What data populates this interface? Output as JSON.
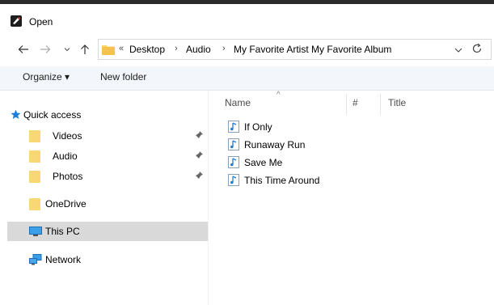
{
  "window": {
    "title": "Open"
  },
  "nav": {
    "back_icon": "back-arrow-icon",
    "forward_icon": "forward-arrow-icon",
    "recent_icon": "chevron-down-icon",
    "up_icon": "up-arrow-icon"
  },
  "address": {
    "overflow": "«",
    "crumbs": [
      "Desktop",
      "Audio",
      "My Favorite Artist My Favorite Album"
    ],
    "separator": "›"
  },
  "toolbar": {
    "organize_label": "Organize ▾",
    "new_folder_label": "New folder"
  },
  "sidebar": {
    "quick_access": "Quick access",
    "items": [
      {
        "label": "Videos",
        "pinned": true
      },
      {
        "label": "Audio",
        "pinned": true
      },
      {
        "label": "Photos",
        "pinned": true
      }
    ],
    "onedrive": "OneDrive",
    "this_pc": "This PC",
    "network": "Network"
  },
  "columns": {
    "name": "Name",
    "number": "#",
    "title": "Title"
  },
  "files": [
    {
      "name": "If Only"
    },
    {
      "name": "Runaway Run"
    },
    {
      "name": "Save Me"
    },
    {
      "name": "This Time Around"
    }
  ],
  "colors": {
    "folder": "#f8d775",
    "selected": "#d9d9d9",
    "accent": "#0078d7"
  }
}
